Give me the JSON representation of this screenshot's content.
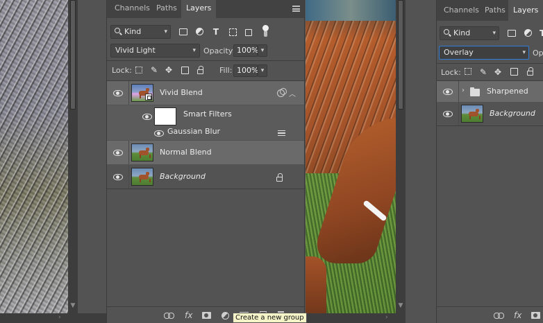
{
  "panel_a": {
    "tabs": [
      "Channels",
      "Paths",
      "Layers"
    ],
    "filter": {
      "kind": "Kind"
    },
    "blend_mode": "Vivid Light",
    "opacity_label": "Opacity:",
    "opacity_value": "100%",
    "lock_label": "Lock:",
    "fill_label": "Fill:",
    "fill_value": "100%",
    "layers": [
      {
        "name": "Vivid Blend"
      },
      {
        "name": "Smart Filters"
      },
      {
        "name": "Gaussian Blur"
      },
      {
        "name": "Normal Blend"
      },
      {
        "name": "Background"
      }
    ],
    "tooltip": "Create a new group"
  },
  "panel_b": {
    "tabs": [
      "Channels",
      "Paths",
      "Layers"
    ],
    "filter": {
      "kind": "Kind"
    },
    "blend_mode": "Overlay",
    "opacity_label": "Opa",
    "lock_label": "Lock:",
    "layers": [
      {
        "name": "Sharpened"
      },
      {
        "name": "Background"
      }
    ]
  },
  "colors": {
    "panel_bg": "#535353",
    "tab_bar": "#424242",
    "selected_row": "#676767",
    "focus_blue": "#2f7bd6"
  },
  "icons": [
    "visibility-eye-icon",
    "search-icon",
    "image-filter-icon",
    "adjustment-filter-icon",
    "type-filter-icon",
    "shape-filter-icon",
    "smart-object-filter-icon",
    "panel-menu-icon",
    "lock-transparent-icon",
    "lock-pixels-icon",
    "lock-position-icon",
    "lock-artboard-icon",
    "lock-all-icon",
    "link-layers-icon",
    "fx-icon",
    "mask-icon",
    "new-adjustment-icon",
    "new-group-icon",
    "new-layer-icon",
    "delete-icon",
    "folder-icon"
  ]
}
